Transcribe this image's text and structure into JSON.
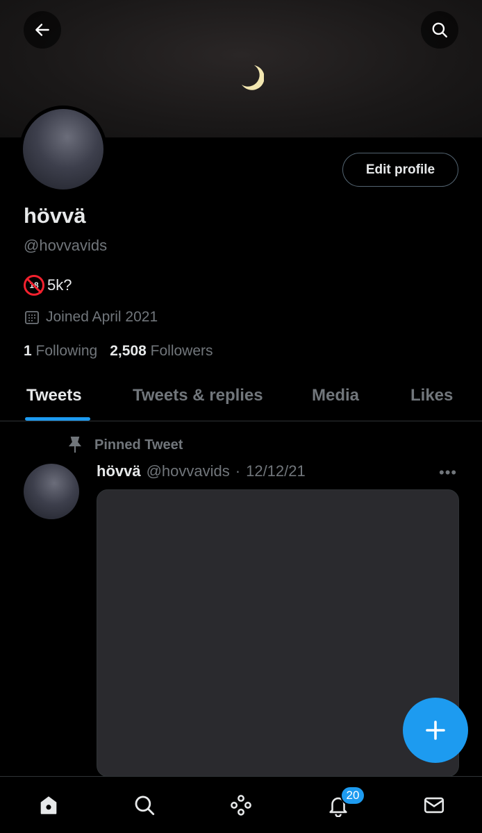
{
  "profile": {
    "name": "hövvä",
    "handle": "@hovvavids",
    "bio": "5k?",
    "bio_emoji": "no-one-under-18-icon",
    "joined": "Joined April 2021",
    "following_count": "1",
    "following_label": "Following",
    "followers_count": "2,508",
    "followers_label": "Followers",
    "edit_label": "Edit profile"
  },
  "tabs": [
    "Tweets",
    "Tweets & replies",
    "Media",
    "Likes"
  ],
  "active_tab": "Tweets",
  "pinned_label": "Pinned Tweet",
  "tweet": {
    "name": "hövvä",
    "handle": "@hovvavids",
    "separator": "·",
    "date": "12/12/21",
    "more": "•••"
  },
  "notifications_badge": "20",
  "colors": {
    "accent": "#1d9bf0",
    "muted": "#71767b",
    "text": "#e7e9ea",
    "border": "#2f3336"
  }
}
